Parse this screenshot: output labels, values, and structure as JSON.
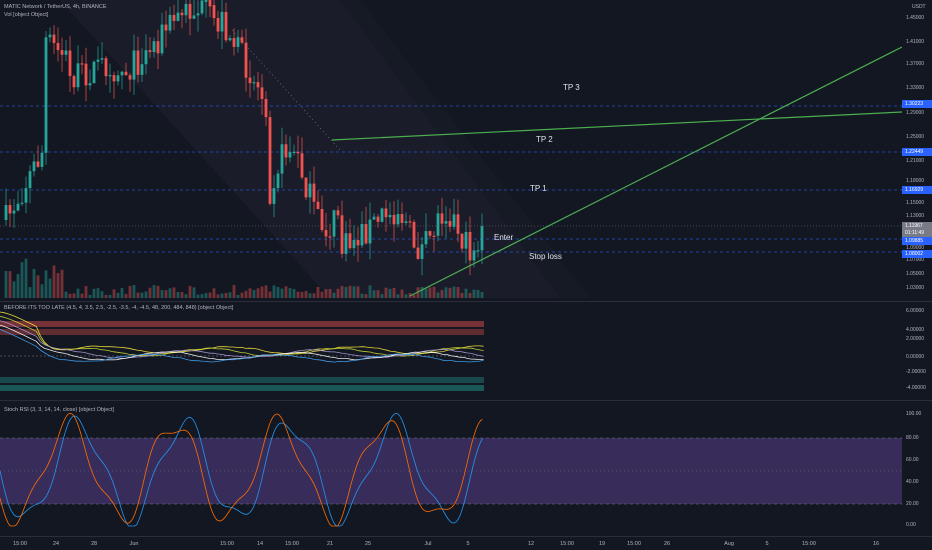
{
  "header": {
    "symbol_line": "MATIC Network / TetherUS, 4h, BINANCE",
    "volume_line": "Vol [object Object]",
    "currency": "USDT"
  },
  "price_axis": {
    "labels": [
      "1.45000",
      "1.41000",
      "1.37000",
      "1.33000",
      "1.29000",
      "1.25000",
      "1.21000",
      "1.18000",
      "1.15000",
      "1.13000",
      "1.09000",
      "1.07000",
      "1.05000",
      "1.03000"
    ],
    "tags": [
      {
        "text": "1.30223",
        "color": "#2962ff"
      },
      {
        "text": "1.22449",
        "color": "#2962ff"
      },
      {
        "text": "1.16929",
        "color": "#2962ff"
      },
      {
        "text": "1.11967",
        "color": "#787b86"
      },
      {
        "text": "01:11:49",
        "color": "#787b86"
      },
      {
        "text": "1.09885",
        "color": "#2962ff"
      },
      {
        "text": "1.08002",
        "color": "#2962ff"
      }
    ]
  },
  "annotations": {
    "tp3": "TP 3",
    "tp2": "TP 2",
    "tp1": "TP 1",
    "enter": "Enter",
    "stop": "Stop loss"
  },
  "indicator1": {
    "title": "BEFORE ITS TOO LATE (4.5, 4, 3.5, 2.5, -2.5, -3.5, -4, -4.5, 48, 200, 484, 848) [object Object]",
    "axis": [
      "6.00000",
      "4.00000",
      "2.00000",
      "0.00000",
      "-2.00000",
      "-4.00000"
    ]
  },
  "indicator2": {
    "title": "Stoch RSI (3, 3, 14, 14, close) [object Object]",
    "axis": [
      "100.00",
      "80.00",
      "60.00",
      "40.00",
      "20.00",
      "0.00"
    ]
  },
  "time_axis": [
    "15:00",
    "24",
    "28",
    "Jun",
    "15:00",
    "14",
    "15:00",
    "21",
    "25",
    "Jul",
    "5",
    "12",
    "15:00",
    "19",
    "15:00",
    "26",
    "Aug",
    "5",
    "15:00",
    "16"
  ],
  "colors": {
    "background": "#131722",
    "up": "#26a69a",
    "down": "#ef5350",
    "trend": "#4caf50",
    "level": "#2962ff",
    "stoch_band": "#7e57c2"
  }
}
